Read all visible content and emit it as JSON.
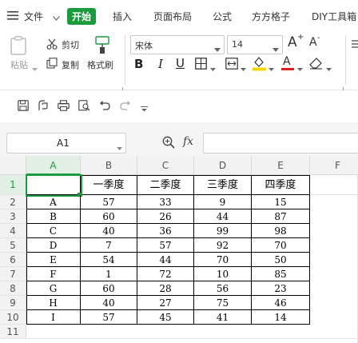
{
  "menubar": {
    "file_label": "文件",
    "tabs": [
      {
        "label": "开始",
        "active": true
      },
      {
        "label": "插入",
        "active": false
      },
      {
        "label": "页面布局",
        "active": false
      },
      {
        "label": "公式",
        "active": false
      },
      {
        "label": "方方格子",
        "active": false
      },
      {
        "label": "DIY工具箱",
        "active": false
      }
    ]
  },
  "ribbon": {
    "paste_label": "粘贴",
    "cut_label": "剪切",
    "copy_label": "复制",
    "format_painter_label": "格式刷",
    "font_name": "宋体",
    "font_size": "14",
    "bold": "B",
    "italic": "I",
    "underline": "U",
    "grow_font": "A",
    "shrink_font": "A",
    "font_color_letter": "A"
  },
  "formula_bar": {
    "name_box": "A1",
    "fx_label": "fx",
    "formula": ""
  },
  "sheet": {
    "columns": [
      "A",
      "B",
      "C",
      "D",
      "E",
      "F"
    ],
    "rows": [
      "1",
      "2",
      "3",
      "4",
      "5",
      "6",
      "7",
      "8",
      "9",
      "10",
      "11"
    ],
    "header_row": [
      "",
      "一季度",
      "二季度",
      "三季度",
      "四季度"
    ],
    "data": [
      [
        "A",
        "57",
        "33",
        "9",
        "15"
      ],
      [
        "B",
        "60",
        "26",
        "44",
        "87"
      ],
      [
        "C",
        "40",
        "36",
        "99",
        "98"
      ],
      [
        "D",
        "7",
        "57",
        "92",
        "70"
      ],
      [
        "E",
        "54",
        "44",
        "70",
        "50"
      ],
      [
        "F",
        "1",
        "72",
        "10",
        "85"
      ],
      [
        "G",
        "60",
        "28",
        "56",
        "23"
      ],
      [
        "H",
        "40",
        "27",
        "75",
        "46"
      ],
      [
        "I",
        "57",
        "45",
        "41",
        "14"
      ]
    ]
  },
  "colors": {
    "accent_green": "#1a9c3e",
    "highlight_yellow": "#f5d400",
    "font_red": "#e02020"
  }
}
